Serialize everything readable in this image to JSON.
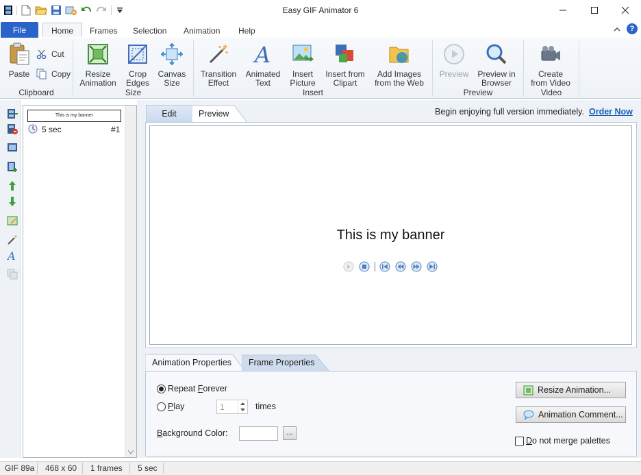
{
  "window": {
    "title": "Easy GIF Animator 6"
  },
  "ribbon_tabs": {
    "file": "File",
    "home": "Home",
    "frames": "Frames",
    "selection": "Selection",
    "animation": "Animation",
    "help": "Help"
  },
  "clipboard": {
    "paste": "Paste",
    "cut": "Cut",
    "copy": "Copy",
    "group": "Clipboard"
  },
  "size": {
    "resize": "Resize\nAnimation",
    "crop": "Crop\nEdges",
    "canvas": "Canvas\nSize",
    "group": "Size"
  },
  "insert": {
    "transition": "Transition\nEffect",
    "text": "Animated\nText",
    "picture": "Insert\nPicture",
    "clipart": "Insert from\nClipart",
    "web": "Add Images\nfrom the Web",
    "group": "Insert"
  },
  "preview_group": {
    "preview": "Preview",
    "browser": "Preview in\nBrowser",
    "group": "Preview"
  },
  "video": {
    "create": "Create\nfrom Video",
    "group": "Video"
  },
  "frames": [
    {
      "thumb_text": "This is my banner",
      "duration": "5 sec",
      "number": "#1"
    }
  ],
  "editor_tabs": {
    "edit": "Edit",
    "preview": "Preview"
  },
  "promo": {
    "text": "Begin enjoying full version immediately.",
    "link": "Order Now"
  },
  "preview": {
    "banner_text": "This is my banner"
  },
  "props_tabs": {
    "animation": "Animation Properties",
    "frame": "Frame Properties"
  },
  "props": {
    "repeat_pre": "Repeat ",
    "repeat_u": "F",
    "repeat_post": "orever",
    "play_u": "P",
    "play_post": "lay",
    "play_times_value": "1",
    "times": "times",
    "bg_u": "B",
    "bg_post": "ackground Color:",
    "browse": "...",
    "resize_btn": "Resize Animation...",
    "comment_btn": "Animation Comment...",
    "merge_u": "D",
    "merge_post": "o not merge palettes"
  },
  "status": {
    "format": "GIF 89a",
    "dimensions": "468 x 60",
    "frames": "1 frames",
    "duration": "5 sec"
  },
  "colors": {
    "accent": "#2a63c9",
    "link": "#1a5fb4"
  }
}
